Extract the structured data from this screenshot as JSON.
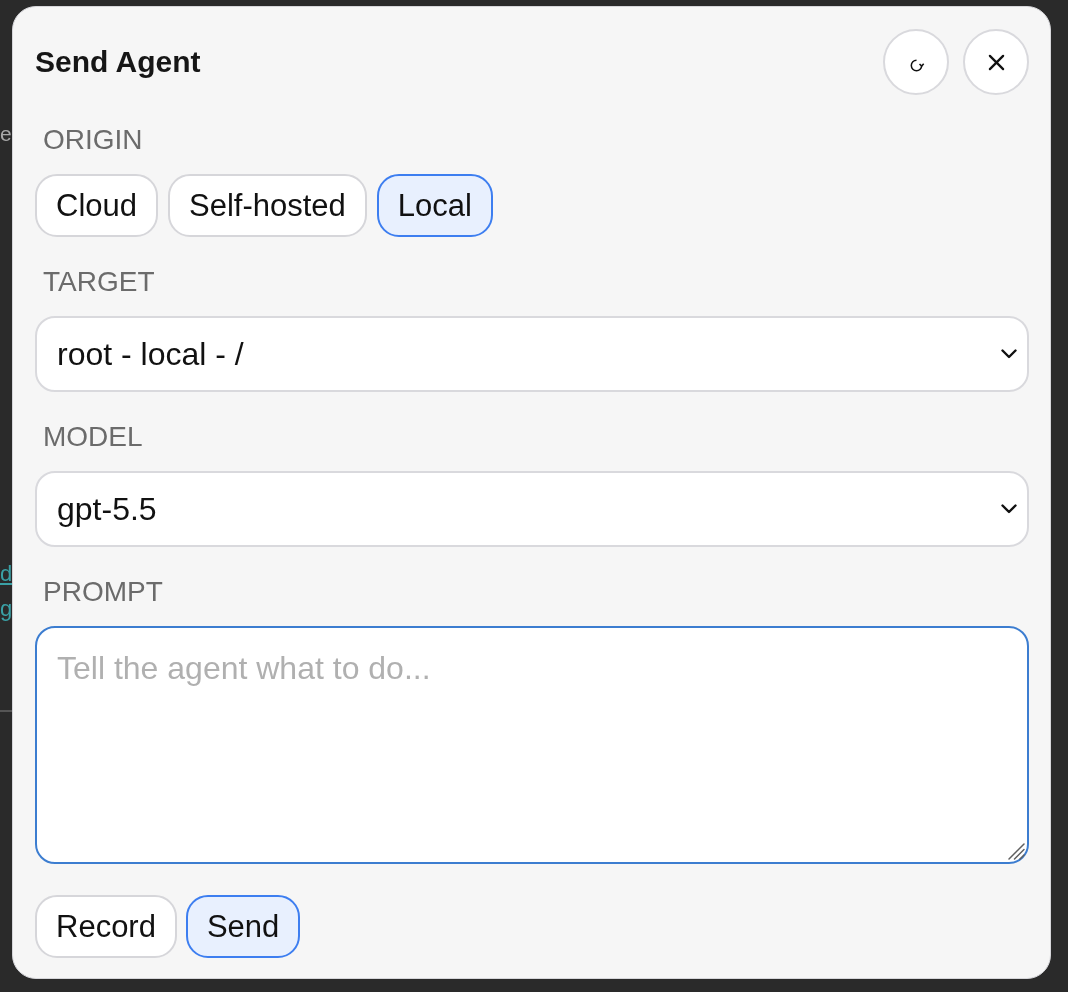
{
  "background": {
    "fragments": [
      {
        "kind": "text",
        "text": "e"
      },
      {
        "kind": "link",
        "text": "d"
      },
      {
        "kind": "link",
        "text": "g"
      }
    ]
  },
  "dialog": {
    "title": "Send Agent",
    "header_buttons": [
      {
        "kind": "refresh"
      },
      {
        "kind": "close"
      }
    ]
  },
  "fields": [
    {
      "kind": "choices",
      "label": "ORIGIN",
      "options": [
        {
          "label": "Cloud",
          "selected": false
        },
        {
          "label": "Self-hosted",
          "selected": false
        },
        {
          "label": "Local",
          "selected": true
        }
      ]
    },
    {
      "kind": "select",
      "label": "TARGET",
      "value": "root - local - /"
    },
    {
      "kind": "select",
      "label": "MODEL",
      "value": "gpt-5.5"
    },
    {
      "kind": "text",
      "label": "PROMPT",
      "placeholder": "Tell the agent what to do...",
      "focused": true
    }
  ],
  "actions": [
    {
      "label": "Record",
      "primary": false
    },
    {
      "label": "Send",
      "primary": true
    }
  ]
}
